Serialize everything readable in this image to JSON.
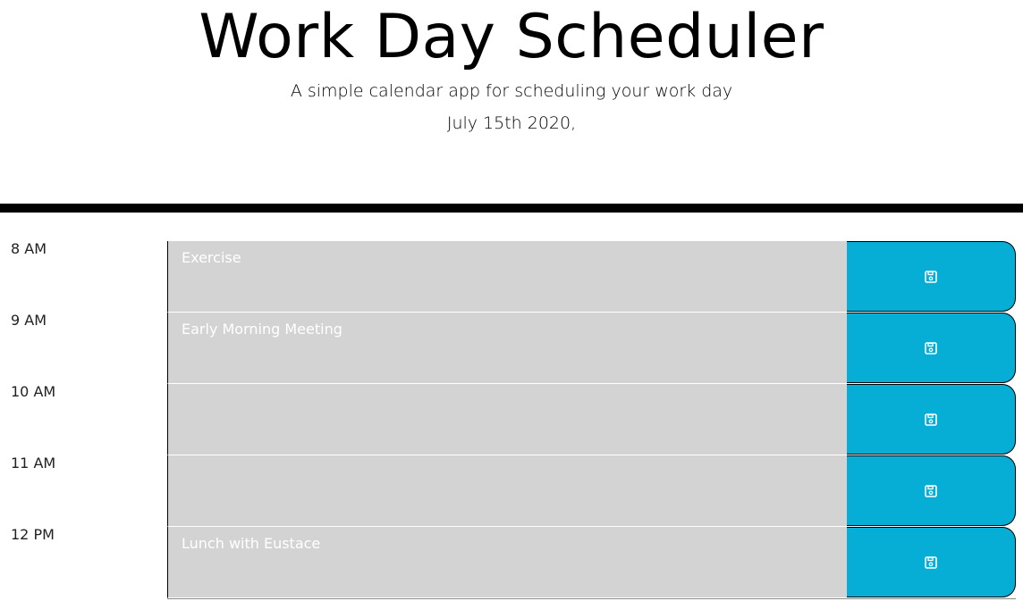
{
  "header": {
    "title": "Work Day Scheduler",
    "subtitle": "A simple calendar app for scheduling your work day",
    "current_day": "July 15th 2020,"
  },
  "colors": {
    "past_block": "#d3d3d3",
    "save_button": "#06aed5",
    "divider": "#000000",
    "text_on_block": "#ffffff"
  },
  "time_blocks": [
    {
      "hour": "8 AM",
      "text": "Exercise",
      "save_icon": "floppy-disk-icon"
    },
    {
      "hour": "9 AM",
      "text": "Early Morning Meeting",
      "save_icon": "floppy-disk-icon"
    },
    {
      "hour": "10 AM",
      "text": "",
      "save_icon": "floppy-disk-icon"
    },
    {
      "hour": "11 AM",
      "text": "",
      "save_icon": "floppy-disk-icon"
    },
    {
      "hour": "12 PM",
      "text": "Lunch with Eustace",
      "save_icon": "floppy-disk-icon"
    }
  ]
}
